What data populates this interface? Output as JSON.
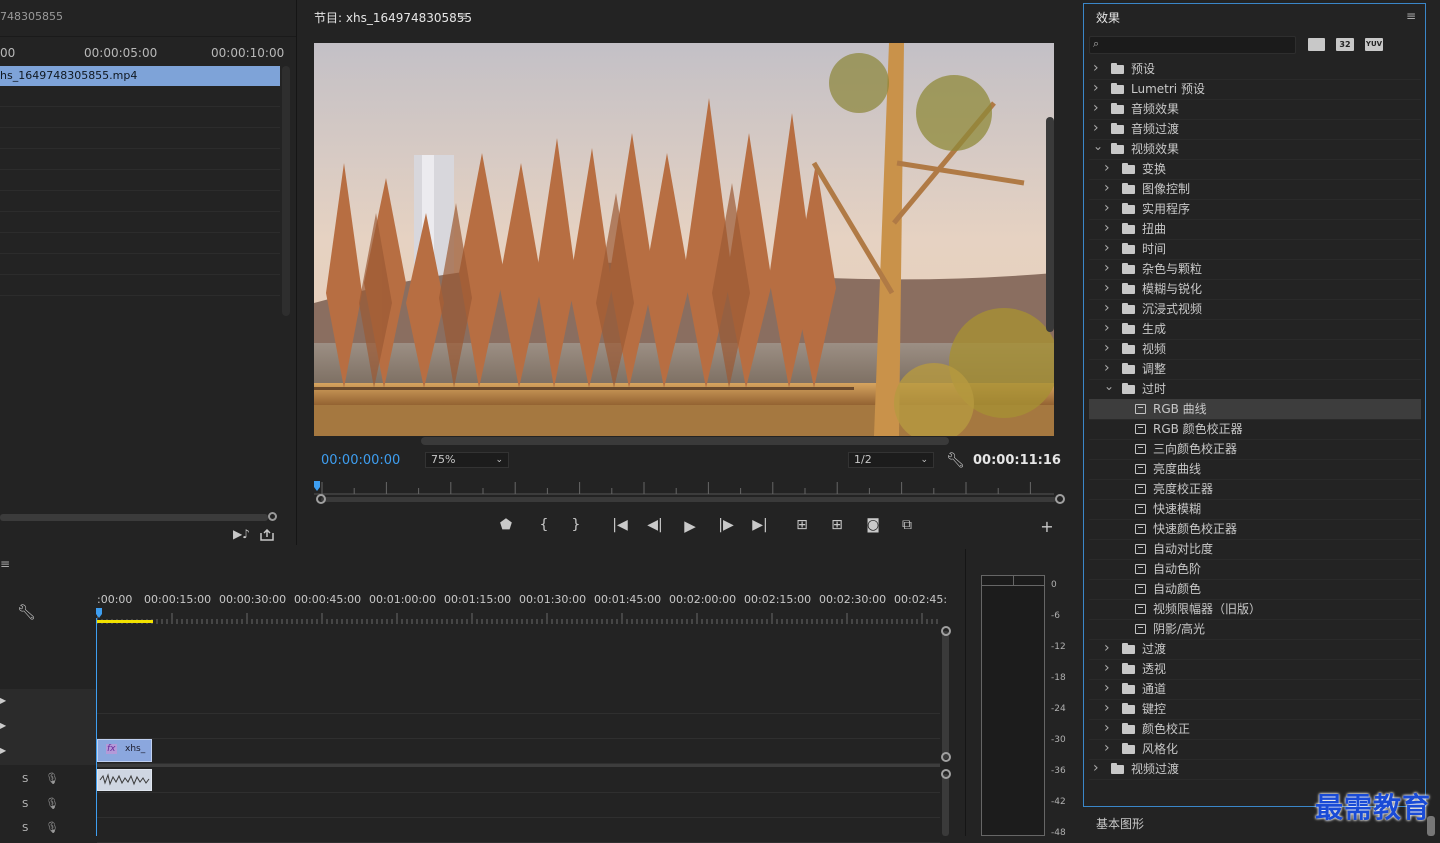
{
  "source": {
    "title": "748305855",
    "ruler": [
      "00",
      "00:00:05:00",
      "00:00:10:00"
    ],
    "clip": "hs_1649748305855.mp4"
  },
  "program": {
    "title": "节目: xhs_1649748305855",
    "current_tc": "00:00:00:00",
    "zoom": "75%",
    "resolution": "1/2",
    "duration_tc": "00:00:11:16"
  },
  "timeline": {
    "ruler": [
      ":00:00",
      "00:00:15:00",
      "00:00:30:00",
      "00:00:45:00",
      "00:01:00:00",
      "00:01:15:00",
      "00:01:30:00",
      "00:01:45:00",
      "00:02:00:00",
      "00:02:15:00",
      "00:02:30:00",
      "00:02:45:"
    ],
    "clip_label": "xhs_",
    "fx_badge": "fx",
    "audio_s": [
      "S",
      "S",
      "S"
    ]
  },
  "meter": {
    "db": [
      "0",
      "-6",
      "-12",
      "-18",
      "-24",
      "-30",
      "-36",
      "-42",
      "-48"
    ]
  },
  "effects": {
    "title": "效果",
    "search_placeholder": "",
    "badges": [
      "32",
      "YUV"
    ],
    "tree": [
      {
        "label": "预设",
        "level": 0,
        "open": false,
        "kind": "preset"
      },
      {
        "label": "Lumetri 预设",
        "level": 0,
        "open": false,
        "kind": "preset"
      },
      {
        "label": "音频效果",
        "level": 0,
        "open": false,
        "kind": "folder"
      },
      {
        "label": "音频过渡",
        "level": 0,
        "open": false,
        "kind": "folder"
      },
      {
        "label": "视频效果",
        "level": 0,
        "open": true,
        "kind": "folder"
      },
      {
        "label": "变换",
        "level": 1,
        "open": false,
        "kind": "folder"
      },
      {
        "label": "图像控制",
        "level": 1,
        "open": false,
        "kind": "folder"
      },
      {
        "label": "实用程序",
        "level": 1,
        "open": false,
        "kind": "folder"
      },
      {
        "label": "扭曲",
        "level": 1,
        "open": false,
        "kind": "folder"
      },
      {
        "label": "时间",
        "level": 1,
        "open": false,
        "kind": "folder"
      },
      {
        "label": "杂色与颗粒",
        "level": 1,
        "open": false,
        "kind": "folder"
      },
      {
        "label": "模糊与锐化",
        "level": 1,
        "open": false,
        "kind": "folder"
      },
      {
        "label": "沉浸式视频",
        "level": 1,
        "open": false,
        "kind": "folder"
      },
      {
        "label": "生成",
        "level": 1,
        "open": false,
        "kind": "folder"
      },
      {
        "label": "视频",
        "level": 1,
        "open": false,
        "kind": "folder"
      },
      {
        "label": "调整",
        "level": 1,
        "open": false,
        "kind": "folder"
      },
      {
        "label": "过时",
        "level": 1,
        "open": true,
        "kind": "folder"
      },
      {
        "label": "RGB 曲线",
        "level": 2,
        "kind": "effect",
        "selected": true
      },
      {
        "label": "RGB 颜色校正器",
        "level": 2,
        "kind": "effect"
      },
      {
        "label": "三向颜色校正器",
        "level": 2,
        "kind": "effect"
      },
      {
        "label": "亮度曲线",
        "level": 2,
        "kind": "effect"
      },
      {
        "label": "亮度校正器",
        "level": 2,
        "kind": "effect"
      },
      {
        "label": "快速模糊",
        "level": 2,
        "kind": "effect"
      },
      {
        "label": "快速颜色校正器",
        "level": 2,
        "kind": "effect"
      },
      {
        "label": "自动对比度",
        "level": 2,
        "kind": "effect"
      },
      {
        "label": "自动色阶",
        "level": 2,
        "kind": "effect"
      },
      {
        "label": "自动颜色",
        "level": 2,
        "kind": "effect"
      },
      {
        "label": "视频限幅器（旧版）",
        "level": 2,
        "kind": "effect"
      },
      {
        "label": "阴影/高光",
        "level": 2,
        "kind": "effect"
      },
      {
        "label": "过渡",
        "level": 1,
        "open": false,
        "kind": "folder"
      },
      {
        "label": "透视",
        "level": 1,
        "open": false,
        "kind": "folder"
      },
      {
        "label": "通道",
        "level": 1,
        "open": false,
        "kind": "folder"
      },
      {
        "label": "键控",
        "level": 1,
        "open": false,
        "kind": "folder"
      },
      {
        "label": "颜色校正",
        "level": 1,
        "open": false,
        "kind": "folder"
      },
      {
        "label": "风格化",
        "level": 1,
        "open": false,
        "kind": "folder"
      },
      {
        "label": "视频过渡",
        "level": 0,
        "open": false,
        "kind": "folder"
      }
    ]
  },
  "essential_graphics": "基本图形",
  "watermark": "最需教育",
  "colors": {
    "accent": "#3e9ef0",
    "panel_border": "#3a86c8",
    "clip": "#7f9fdb",
    "playhead_bar": "#f2e200"
  }
}
